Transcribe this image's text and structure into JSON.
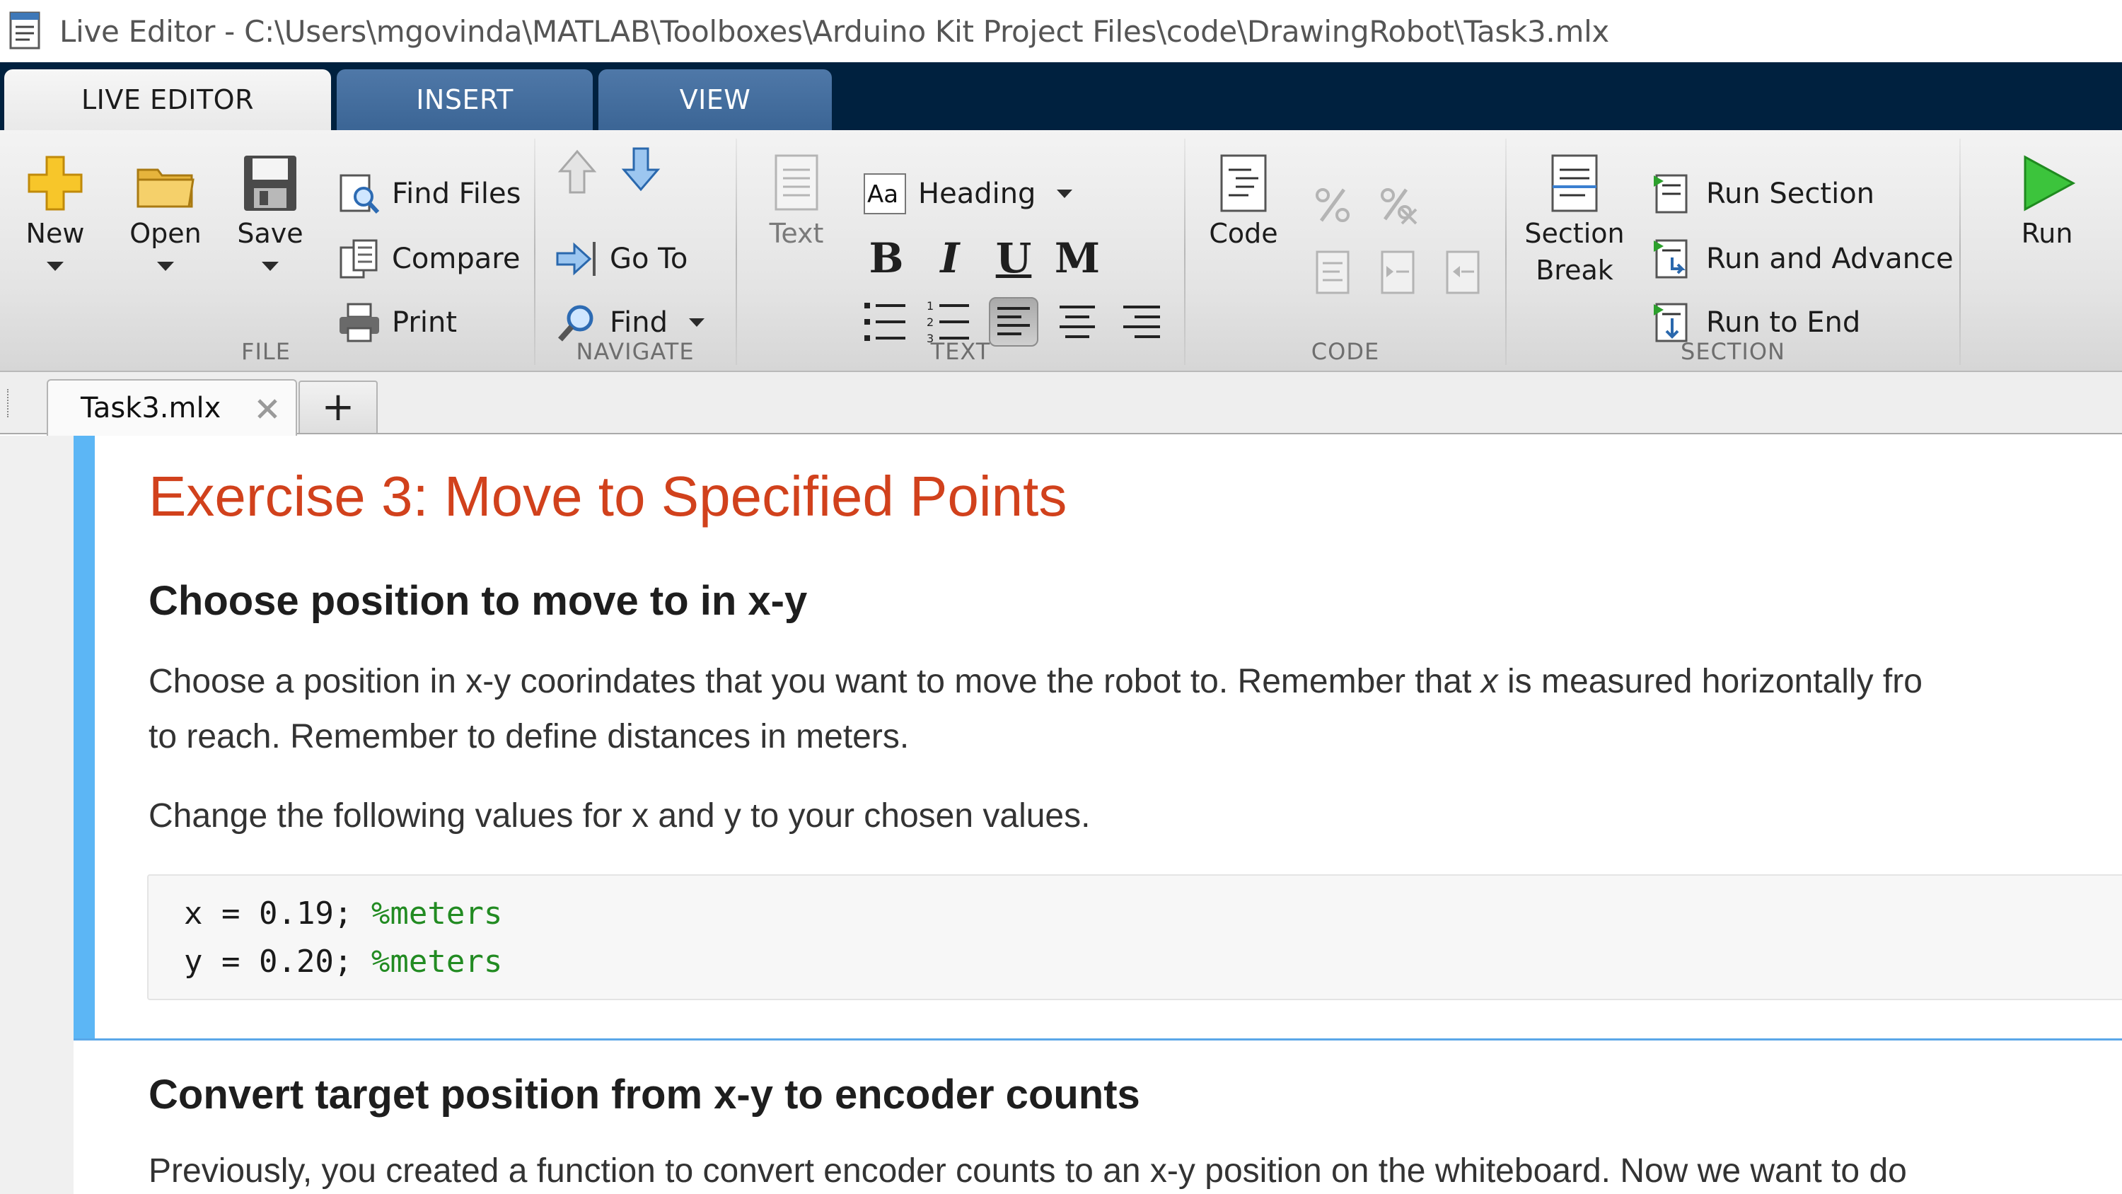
{
  "window": {
    "title": "Live Editor - C:\\Users\\mgovinda\\MATLAB\\Toolboxes\\Arduino Kit Project Files\\code\\DrawingRobot\\Task3.mlx"
  },
  "ribbon_tabs": [
    {
      "label": "LIVE EDITOR",
      "active": true
    },
    {
      "label": "INSERT",
      "active": false
    },
    {
      "label": "VIEW",
      "active": false
    }
  ],
  "ribbon": {
    "file": {
      "group_label": "FILE",
      "new": "New",
      "open": "Open",
      "save": "Save",
      "find_files": "Find Files",
      "compare": "Compare",
      "print": "Print"
    },
    "navigate": {
      "group_label": "NAVIGATE",
      "go_to": "Go To",
      "find": "Find"
    },
    "text": {
      "group_label": "TEXT",
      "text_button": "Text",
      "style_select": "Heading",
      "bold": "B",
      "italic": "I",
      "underline": "U",
      "monospace": "M"
    },
    "code": {
      "group_label": "CODE",
      "code_button": "Code"
    },
    "section": {
      "group_label": "SECTION",
      "section_break_line1": "Section",
      "section_break_line2": "Break",
      "run_section": "Run Section",
      "run_and_advance": "Run and Advance",
      "run_to_end": "Run to End"
    },
    "run": {
      "label": "Run"
    }
  },
  "document_tabs": {
    "active_tab": "Task3.mlx",
    "add_label": "+"
  },
  "document": {
    "title": "Exercise 3: Move to Specified Points",
    "section1_heading": "Choose position to move to in x-y",
    "para1_line1_a": "Choose a position in x-y coorindates that you want to move the robot to. Remember that ",
    "para1_line1_x": "x",
    "para1_line1_b": " is measured horizontally fro",
    "para1_line2": "to reach. Remember to define  distances in meters.",
    "para2": "Change the following values for x and y to your chosen values.",
    "code": [
      {
        "code": "x = 0.19; ",
        "comment": "%meters"
      },
      {
        "code": "y = 0.20; ",
        "comment": "%meters"
      }
    ],
    "section2_heading": "Convert target position from x-y to encoder counts",
    "para3": "Previously, you created a function to convert encoder counts to an x-y position on the whiteboard. Now we want to do"
  },
  "colors": {
    "title_accent": "#d1411c",
    "section_bar": "#5cb6f5",
    "code_comment": "#228b22",
    "ribbon_tabstrip": "#00213f"
  }
}
